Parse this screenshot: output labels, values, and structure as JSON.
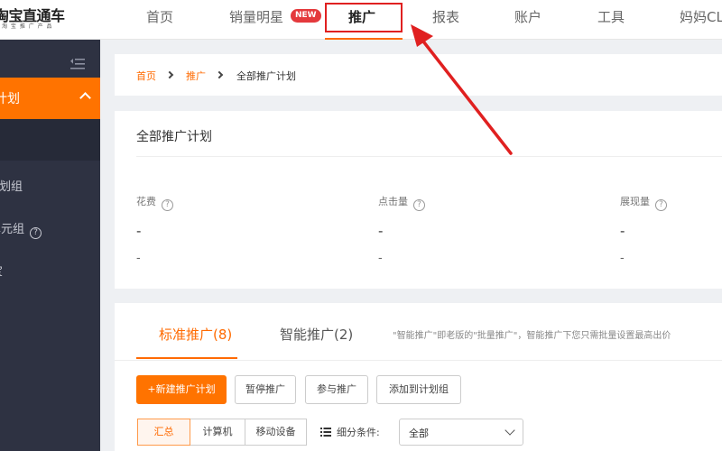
{
  "brand": {
    "name": "淘宝直通车",
    "tagline": "淘 宝 推 广 产 品"
  },
  "nav": {
    "items": [
      "首页",
      "销量明星",
      "推广",
      "报表",
      "账户",
      "工具",
      "妈妈CLUB"
    ],
    "new_badge": "NEW",
    "active": "推广"
  },
  "sidebar": {
    "active_label": "计划",
    "items": [
      "计划组",
      "单元组",
      "宝"
    ]
  },
  "breadcrumb": {
    "home": "首页",
    "section": "推广",
    "current": "全部推广计划"
  },
  "summary": {
    "title": "全部推广计划",
    "metrics": [
      {
        "label": "花费",
        "value": "-",
        "sub": "-"
      },
      {
        "label": "点击量",
        "value": "-",
        "sub": "-"
      },
      {
        "label": "展现量",
        "value": "-",
        "sub": "-"
      }
    ]
  },
  "plans": {
    "tabs": [
      "标准推广(8)",
      "智能推广(2)"
    ],
    "note": "\"智能推广\"即老版的\"批量推广\"，智能推广下您只需批量设置最高出价",
    "buttons": [
      "+新建推广计划",
      "暂停推广",
      "参与推广",
      "添加到计划组"
    ],
    "segments": [
      "汇总",
      "计算机",
      "移动设备"
    ],
    "filter_label": "细分条件:",
    "filter_value": "全部"
  },
  "colors": {
    "accent": "#ff6a00",
    "sidebar": "#2e3242",
    "annotation": "#e02020"
  }
}
